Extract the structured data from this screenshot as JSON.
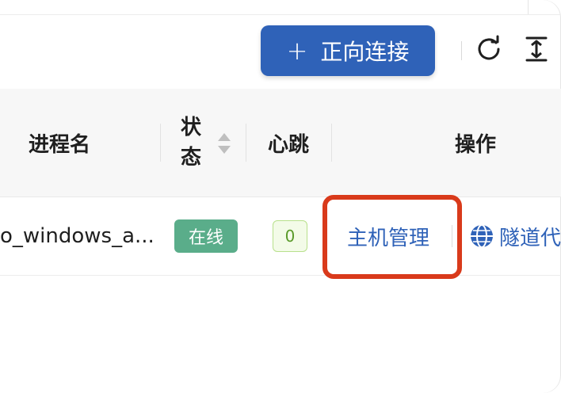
{
  "toolbar": {
    "add_button_icon": "plus",
    "add_button_label": "正向连接",
    "refresh_icon": "refresh-icon",
    "density_icon": "column-height-icon"
  },
  "table": {
    "columns": {
      "process_name": "进程名",
      "status_line1": "状",
      "status_line2": "态",
      "heartbeat": "心跳",
      "actions": "操作"
    },
    "rows": [
      {
        "process_name": "o_windows_a...",
        "status": "在线",
        "heartbeat": "0",
        "actions": {
          "host_manage": "主机管理",
          "tunnel_proxy": "隧道代"
        }
      }
    ]
  },
  "colors": {
    "primary": "#2f62b8",
    "online_tag": "#5aad8a",
    "heartbeat_tag_bg": "#f3fbe8",
    "heartbeat_tag_border": "#b8e08c",
    "highlight": "#d93a1b"
  }
}
